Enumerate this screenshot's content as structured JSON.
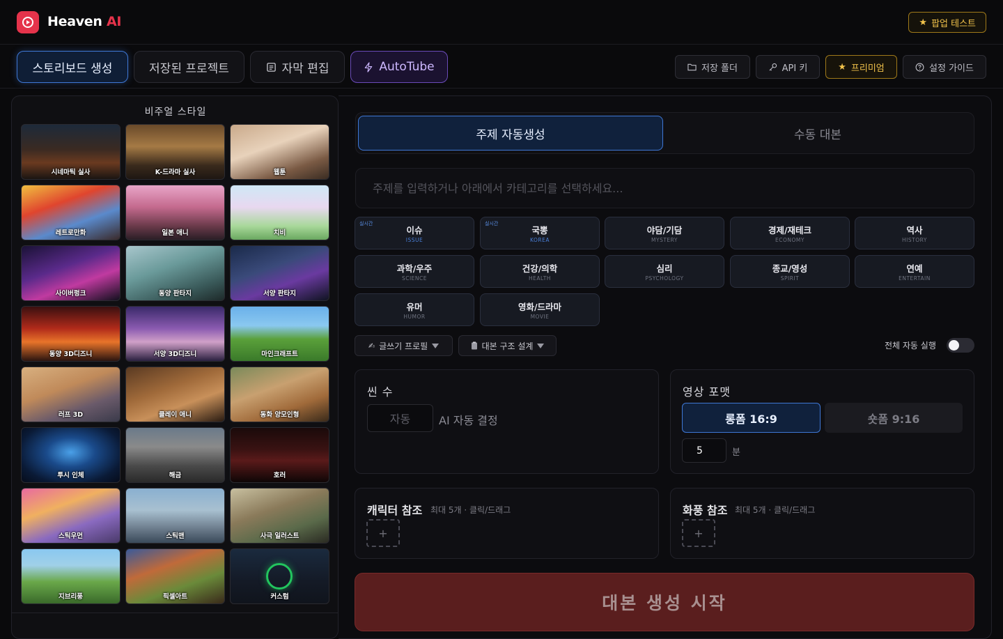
{
  "app": {
    "brand_main": "Heaven",
    "brand_ai": "AI",
    "popup_test": "팝업 테스트"
  },
  "nav": {
    "tabs": [
      {
        "label": "스토리보드 생성",
        "active": true
      },
      {
        "label": "저장된 프로젝트"
      },
      {
        "label": "자막 편집"
      },
      {
        "label": "AutoTube"
      }
    ],
    "tools": [
      {
        "label": "저장 폴더",
        "icon": "folder-icon"
      },
      {
        "label": "API 키",
        "icon": "key-icon"
      },
      {
        "label": "프리미엄",
        "icon": "star-icon"
      },
      {
        "label": "설정 가이드",
        "icon": "help-circle-icon"
      }
    ]
  },
  "styles": {
    "title": "비주얼 스타일",
    "items": [
      "시네마틱 실사",
      "K-드라마 실사",
      "웹툰",
      "레트로만화",
      "일본 애니",
      "치비",
      "사이버펑크",
      "동양 판타지",
      "서양 판타지",
      "동양 3D디즈니",
      "서양 3D디즈니",
      "마인크래프트",
      "러프 3D",
      "클레이 애니",
      "동화 양모인형",
      "투시 인체",
      "해금",
      "호러",
      "스틱우먼",
      "스틱맨",
      "사극 일러스트",
      "지브리풍",
      "픽셀아트",
      "커스텀"
    ]
  },
  "main": {
    "segment": {
      "auto": "주제 자동생성",
      "manual": "수동 대본"
    },
    "topic_placeholder": "주제를 입력하거나 아래에서 카테고리를 선택하세요...",
    "categories": [
      {
        "label": "이슈",
        "sub": "ISSUE",
        "live": "실시간"
      },
      {
        "label": "국뽕",
        "sub": "KOREA",
        "live": "실시간"
      },
      {
        "label": "야담/기담",
        "sub": "MYSTERY"
      },
      {
        "label": "경제/재테크",
        "sub": "ECONOMY"
      },
      {
        "label": "역사",
        "sub": "HISTORY"
      },
      {
        "label": "과학/우주",
        "sub": "SCIENCE"
      },
      {
        "label": "건강/의학",
        "sub": "HEALTH"
      },
      {
        "label": "심리",
        "sub": "PSYCHOLOGY"
      },
      {
        "label": "종교/영성",
        "sub": "SPIRIT"
      },
      {
        "label": "연예",
        "sub": "ENTERTAIN"
      },
      {
        "label": "유머",
        "sub": "HUMOR"
      },
      {
        "label": "영화/드라마",
        "sub": "MOVIE"
      }
    ],
    "writer_profile": "글쓰기 프로필",
    "script_structure": "대본 구조 설계",
    "auto_run_label": "전체 자동 실행",
    "auto_run_on": false,
    "scene_count": {
      "title": "씬 수",
      "value": "자동",
      "hint": "AI 자동 결정"
    },
    "video_format": {
      "title": "영상 포맷",
      "long": "롱폼 16:9",
      "short": "숏폼 9:16",
      "minutes": "5",
      "unit": "분"
    },
    "character_ref": {
      "title": "캐릭터 참조",
      "hint": "최대 5개 · 클릭/드래그",
      "add": "+"
    },
    "art_ref": {
      "title": "화풍 참조",
      "hint": "최대 5개 · 클릭/드래그",
      "add": "+"
    },
    "start_button": "대본 생성 시작"
  },
  "colors": {
    "accent_blue": "#3f78d6",
    "brand_red": "#e5334b",
    "gold": "#f1c24b",
    "start_red": "#5a1e1e"
  }
}
